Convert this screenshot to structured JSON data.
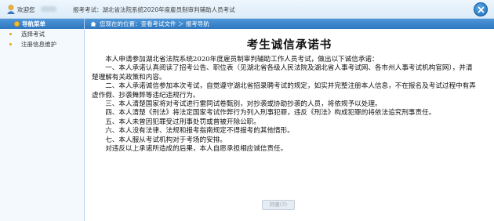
{
  "topbar": {
    "welcome": "欢迎您",
    "exam_info": "报考考试：湖北省法院系统2020年度雇员制审判辅助人员考试"
  },
  "sidebar": {
    "header": "导航菜单",
    "items": [
      {
        "label": "选择考试"
      },
      {
        "label": "注册信息维护"
      }
    ]
  },
  "breadcrumb": "您现在的位置：查看考试文件 ＞ 报考导航",
  "document": {
    "title": "考生诚信承诺书",
    "paragraphs": [
      "本人申请参加湖北省法院系统2020年度雇员制审判辅助工作人员考试，做出以下诚信承诺：",
      "一、本人承诺认真阅读了招考公告、职位表（见湖北省各级人民法院及湖北省人事考试网、各市州人事考试机构官网），并清楚理解有关政策和内容。",
      "二、本人承诺诚信参加本次考试，自觉遵守湖北省招录聘考试的规定，如实并完整注册本人信息，不在报名及考试过程中有弄虚作假、抄袭舞弊等违纪违规行为。",
      "三、本人清楚国家将对考试进行雷同试卷甄别，对抄袭或协助抄袭的人员，将依规予以处理。",
      "四、本人清楚《刑法》将法定国家考试作弊行为列入刑事犯罪，违反《刑法》构成犯罪的将依法追究刑事责任。",
      "五、本人未曾因犯罪受过刑事处罚或曾被开除公职。",
      "六、本人没有法律、法规和报考指南规定不得报考的其他情形。",
      "七、本人服从考试机构对于考场的安排。",
      "对违反以上承诺所造成的后果，本人自愿承担相应诚信责任。"
    ],
    "agree_button": "同意(7)"
  }
}
